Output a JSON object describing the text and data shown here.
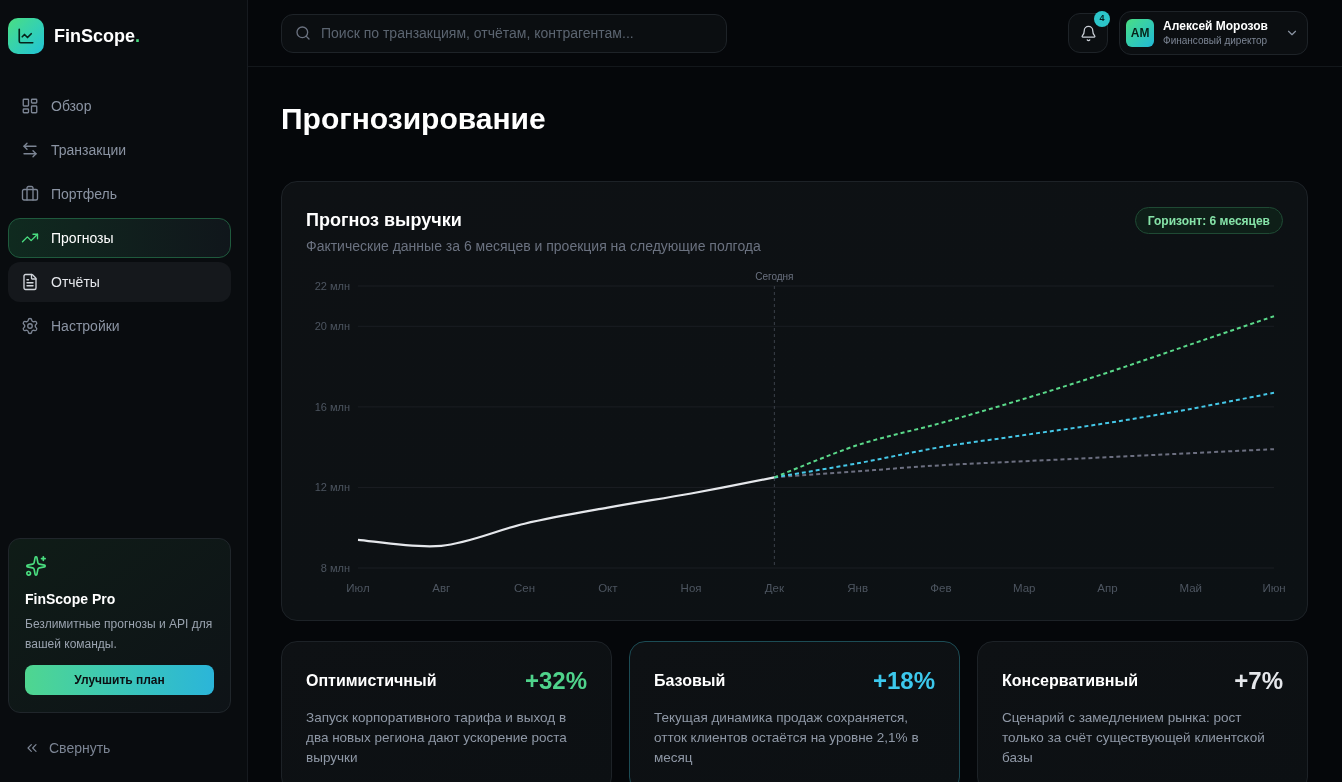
{
  "sidebar": {
    "brand": {
      "name": "FinScope",
      "accent": "."
    },
    "nav": [
      {
        "label": "Обзор",
        "selected": false,
        "hovered": false
      },
      {
        "label": "Транзакции",
        "selected": false,
        "hovered": false
      },
      {
        "label": "Портфель",
        "selected": false,
        "hovered": false
      },
      {
        "label": "Прогнозы",
        "selected": true,
        "hovered": false
      },
      {
        "label": "Отчёты",
        "selected": false,
        "hovered": true
      },
      {
        "label": "Настройки",
        "selected": false,
        "hovered": false
      }
    ],
    "promo": {
      "title": "FinScope Pro",
      "text": "Безлимитные прогнозы и API для вашей команды.",
      "button": "Улучшить план"
    },
    "collapse": {
      "label": "Свернуть"
    }
  },
  "header": {
    "search": {
      "placeholder": "Поиск по транзакциям, отчётам, контрагентам..."
    },
    "notifications": {
      "count": "4"
    },
    "user": {
      "initials": "АМ",
      "name": "Алексей Морозов",
      "role": "Финансовый директор"
    }
  },
  "page": {
    "title": "Прогнозирование"
  },
  "forecast_card": {
    "title": "Прогноз выручки",
    "subtitle": "Фактические данные за 6 месяцев и проекция на следующие полгода",
    "badge": "Горизонт: 6 месяцев",
    "chart_data": {
      "type": "line",
      "categories": [
        "Июл",
        "Авг",
        "Сен",
        "Окт",
        "Ноя",
        "Дек",
        "Янв",
        "Фев",
        "Мар",
        "Апр",
        "Май",
        "Июн"
      ],
      "ylim": [
        8,
        22
      ],
      "yticks": [
        {
          "value": 8,
          "label": "8 млн"
        },
        {
          "value": 12,
          "label": "12 млн"
        },
        {
          "value": 16,
          "label": "16 млн"
        },
        {
          "value": 20,
          "label": "20 млн"
        },
        {
          "value": 22,
          "label": "22 млн"
        }
      ],
      "grid": true,
      "series": [
        {
          "line_style": "solid",
          "color": "#e5e7eb",
          "values": [
            9.4,
            9.1,
            10.2,
            11.0,
            11.7,
            12.5,
            null,
            null,
            null,
            null,
            null,
            null
          ]
        },
        {
          "line_style": "dashed",
          "color": "#5ad98a",
          "values": [
            null,
            null,
            null,
            null,
            null,
            12.5,
            14.1,
            15.2,
            16.4,
            17.7,
            19.1,
            20.5
          ]
        },
        {
          "line_style": "dashed",
          "color": "#45c8e8",
          "values": [
            null,
            null,
            null,
            null,
            null,
            12.5,
            13.2,
            14.0,
            14.6,
            15.2,
            15.9,
            16.7
          ]
        },
        {
          "line_style": "dashed",
          "color": "#6c6f80",
          "values": [
            null,
            null,
            null,
            null,
            null,
            12.5,
            12.8,
            13.1,
            13.3,
            13.5,
            13.7,
            13.9
          ]
        }
      ],
      "ref_lines": [
        {
          "axis": "x",
          "value": "Дек",
          "label": "Сегодня",
          "line_style": "dashed"
        }
      ]
    }
  },
  "scenarios": [
    {
      "title": "Оптимистичный",
      "change": "+32%",
      "color": "#4fd38b",
      "selected": false,
      "text": "Запуск корпоративного тарифа и выход в два новых региона дают ускорение роста выручки"
    },
    {
      "title": "Базовый",
      "change": "+18%",
      "color": "#3cc8ec",
      "selected": true,
      "text": "Текущая динамика продаж сохраняется, отток клиентов остаётся на уровне 2,1% в месяц"
    },
    {
      "title": "Консервативный",
      "change": "+7%",
      "color": "#e5e7eb",
      "selected": false,
      "text": "Сценарий с замедлением рынка: рост только за счёт существующей клиентской базы"
    }
  ]
}
